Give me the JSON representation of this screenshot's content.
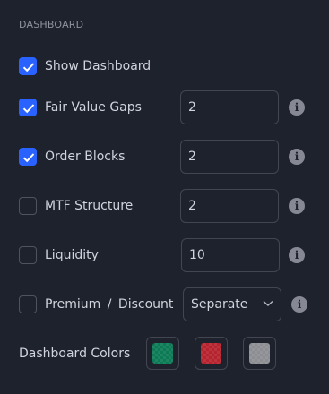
{
  "section": {
    "title": "DASHBOARD"
  },
  "rows": [
    {
      "label": "Show Dashboard",
      "checked": true
    },
    {
      "label": "Fair Value Gaps",
      "checked": true,
      "value": "2"
    },
    {
      "label": "Order Blocks",
      "checked": true,
      "value": "2"
    },
    {
      "label": "MTF Structure",
      "checked": false,
      "value": "2"
    },
    {
      "label": "Liquidity",
      "checked": false,
      "value": "10"
    },
    {
      "label": "Premium / Discount",
      "checked": false,
      "select": "Separate"
    }
  ],
  "colors": {
    "label": "Dashboard Colors",
    "swatches": [
      "#0b7a55",
      "#b5232e",
      "#8c8e93"
    ]
  },
  "info_glyph": "i"
}
